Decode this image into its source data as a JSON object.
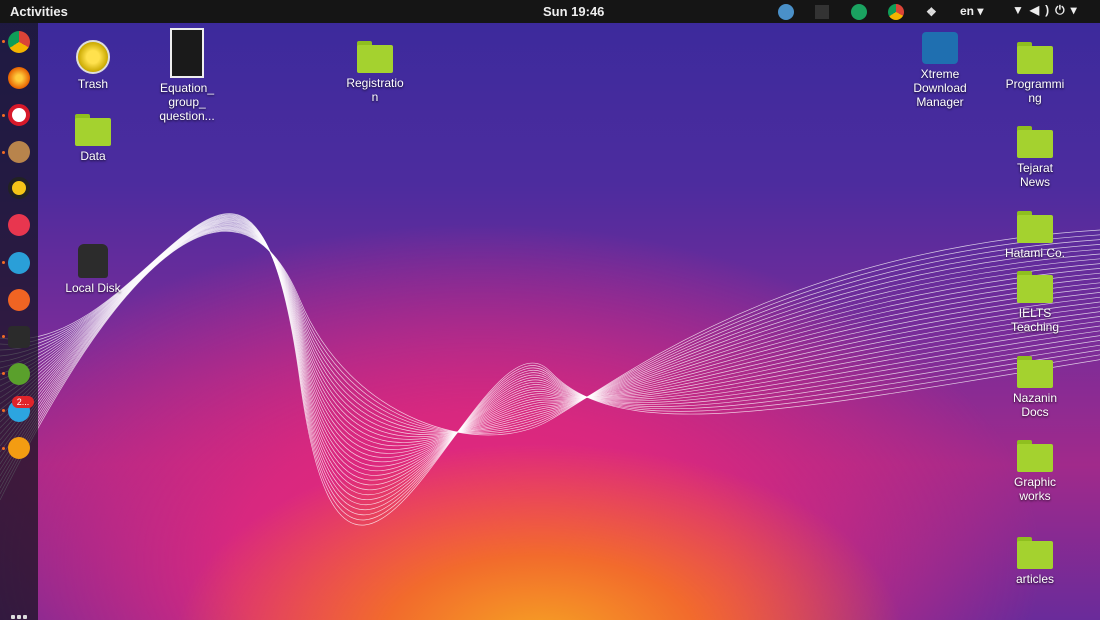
{
  "topbar": {
    "activities": "Activities",
    "clock": "Sun 19:46",
    "language": "en"
  },
  "dock": {
    "badge_count": "2..."
  },
  "desktop": {
    "trash": "Trash",
    "equation_file": "Equation_\ngroup_\nquestion...",
    "data": "Data",
    "local_disk": "Local Disk",
    "registration": "Registratio\nn",
    "xdm": "Xtreme\nDownload\nManager",
    "programming": "Programmi\nng",
    "tejarat": "Tejarat\nNews",
    "hatami": "Hatami Co.",
    "ielts": "IELTS\nTeaching",
    "nazanin": "Nazanin\nDocs",
    "graphic": "Graphic\nworks",
    "articles": "articles"
  },
  "colors": {
    "folder": "#a4d22f",
    "panel": "#151515",
    "dock": "#1e1e28"
  }
}
